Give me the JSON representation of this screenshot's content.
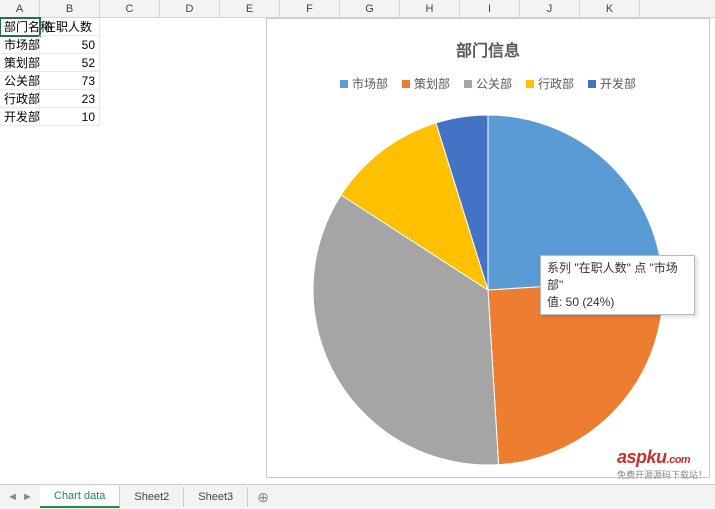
{
  "columns": [
    "A",
    "B",
    "C",
    "D",
    "E",
    "F",
    "G",
    "H",
    "I",
    "J",
    "K"
  ],
  "table": {
    "headers": [
      "部门名称",
      "在职人数"
    ],
    "rows": [
      {
        "name": "市场部",
        "count": 50
      },
      {
        "name": "策划部",
        "count": 52
      },
      {
        "name": "公关部",
        "count": 73
      },
      {
        "name": "行政部",
        "count": 23
      },
      {
        "name": "开发部",
        "count": 10
      }
    ]
  },
  "chart_data": {
    "type": "pie",
    "title": "部门信息",
    "series_name": "在职人数",
    "categories": [
      "市场部",
      "策划部",
      "公关部",
      "行政部",
      "开发部"
    ],
    "values": [
      50,
      52,
      73,
      23,
      10
    ],
    "colors": [
      "#5b9bd5",
      "#ed7d31",
      "#a5a5a5",
      "#ffc000",
      "#4472c4"
    ],
    "legend_position": "top"
  },
  "tooltip": {
    "line1": "系列 \"在职人数\" 点 \"市场部\"",
    "line2": "值: 50 (24%)"
  },
  "sheets": {
    "active": "Chart data",
    "tabs": [
      "Chart data",
      "Sheet2",
      "Sheet3"
    ]
  },
  "watermark": {
    "brand": "aspku",
    "suffix": ".com",
    "tagline": "免费开源源码下载站！"
  }
}
